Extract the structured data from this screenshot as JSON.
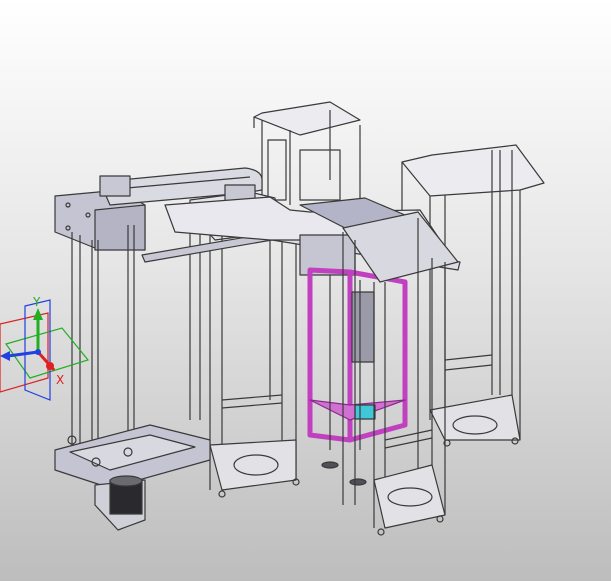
{
  "viewport": {
    "background_top": "#ffffff",
    "background_bottom": "#bdbdbd",
    "model": "machine-frame-assembly"
  },
  "triad": {
    "x_label": "X",
    "y_label": "Y",
    "x_color": "#e02020",
    "y_color": "#20b020",
    "z_color": "#2040e0"
  },
  "colors": {
    "frame_stroke": "#3a3a3a",
    "frame_fill": "#d6d6dc",
    "plate_fill": "#b8b8c8",
    "highlight": "#c040c0",
    "accent_cyan": "#40c8d8"
  }
}
